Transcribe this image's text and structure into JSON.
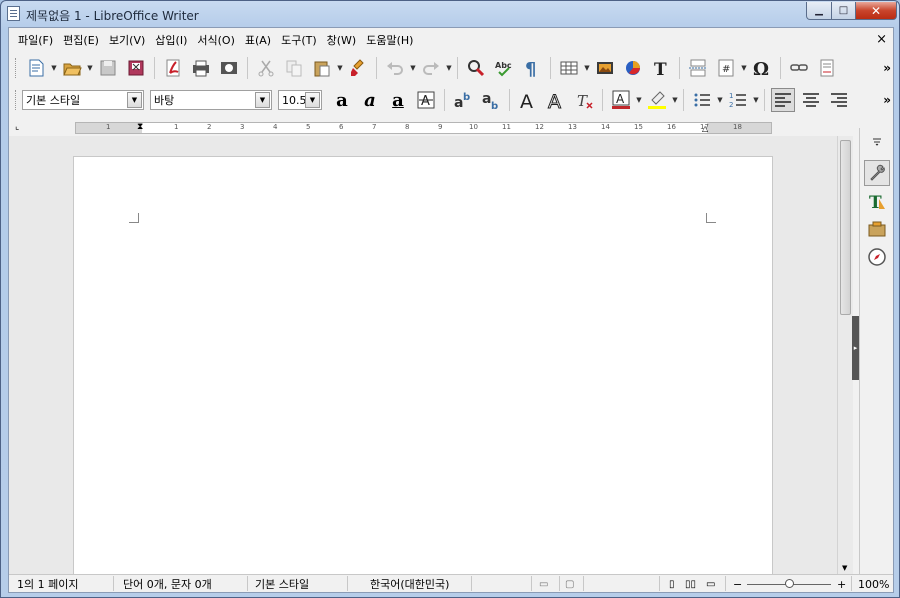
{
  "window": {
    "title": "제목없음 1 - LibreOffice Writer",
    "minimize_label": "▁",
    "maximize_label": "□",
    "close_label": "✕"
  },
  "menu": {
    "items": [
      "파일(F)",
      "편집(E)",
      "보기(V)",
      "삽입(I)",
      "서식(O)",
      "표(A)",
      "도구(T)",
      "창(W)",
      "도움말(H)"
    ],
    "doc_close": "×"
  },
  "toolbar2": {
    "paragraph_style": "기본 스타일",
    "font_name": "바탕",
    "font_size": "10.5"
  },
  "ruler": {
    "numbers": [
      "1",
      "1",
      "2",
      "3",
      "4",
      "5",
      "6",
      "7",
      "8",
      "9",
      "10",
      "11",
      "12",
      "13",
      "14",
      "15",
      "16",
      "17",
      "18"
    ]
  },
  "statusbar": {
    "page": "1의 1 페이지",
    "word_count": "단어 0개, 문자 0개",
    "page_style": "기본 스타일",
    "language": "한국어(대한민국)",
    "zoom_minus": "−",
    "zoom_plus": "+",
    "zoom": "100%"
  },
  "colors": {
    "font_color_bar": "#c0282c",
    "highlight_bar": "#ffff00",
    "title_text": "#1e2a3c"
  },
  "icons": [
    "new-document-icon",
    "open-folder-icon",
    "save-icon",
    "export-icon",
    "export-pdf-icon",
    "print-icon",
    "print-preview-icon",
    "cut-icon",
    "copy-icon",
    "paste-icon",
    "clone-formatting-icon",
    "undo-icon",
    "redo-icon",
    "find-replace-icon",
    "spelling-icon",
    "formatting-marks-icon",
    "insert-table-icon",
    "insert-image-icon",
    "insert-chart-icon",
    "insert-textbox-icon",
    "page-break-icon",
    "field-icon",
    "special-character-icon",
    "hyperlink-icon",
    "footnote-icon"
  ],
  "sidebar_icons": [
    "properties-icon",
    "styles-icon",
    "gallery-icon",
    "navigator-icon"
  ]
}
